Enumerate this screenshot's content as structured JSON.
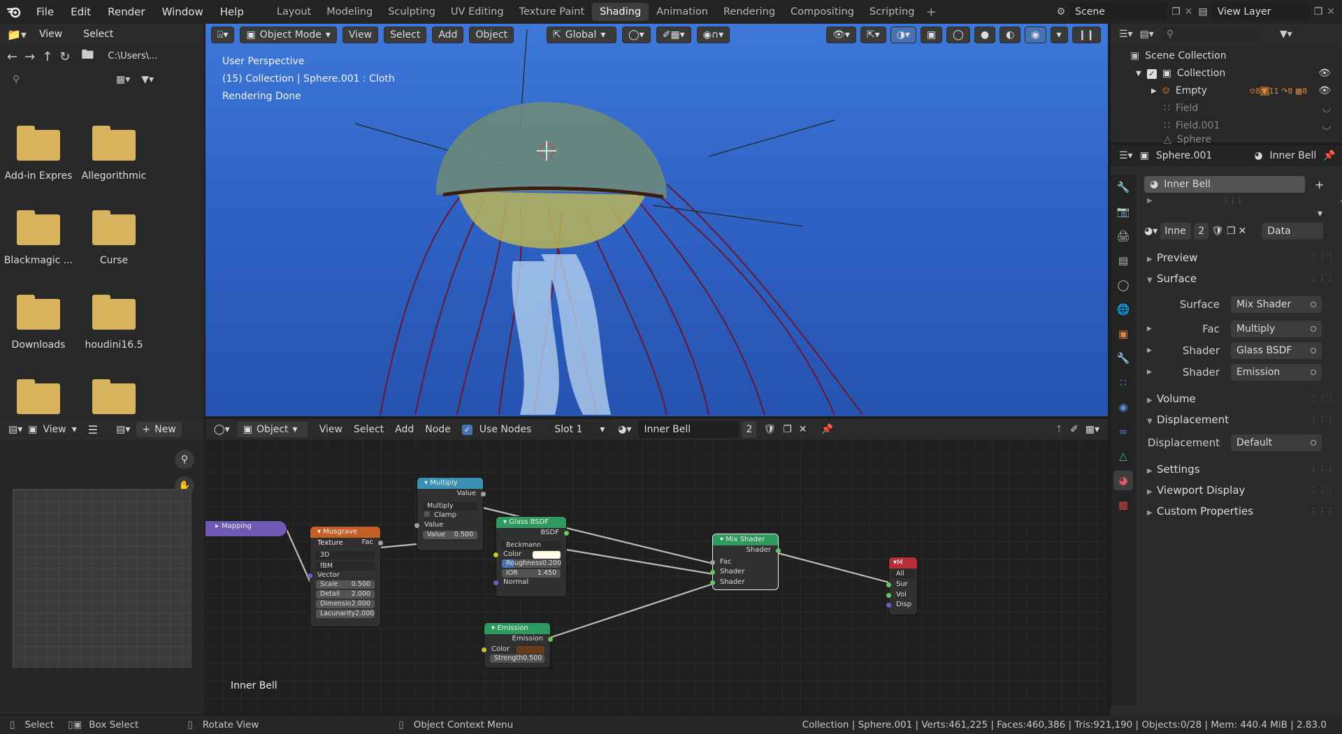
{
  "topbar": {
    "menus": [
      "File",
      "Edit",
      "Render",
      "Window",
      "Help"
    ],
    "workspaces": [
      "Layout",
      "Modeling",
      "Sculpting",
      "UV Editing",
      "Texture Paint",
      "Shading",
      "Animation",
      "Rendering",
      "Compositing",
      "Scripting"
    ],
    "active_workspace": "Shading",
    "scene": "Scene",
    "view_layer": "View Layer"
  },
  "file_browser": {
    "menus": [
      "View",
      "Select"
    ],
    "path": "C:\\Users\\...",
    "folders": [
      "Add-in Expres",
      "Allegorithmic",
      "Blackmagic ...",
      "Curse",
      "Downloads",
      "houdini16.5",
      "",
      ""
    ]
  },
  "viewport": {
    "mode": "Object Mode",
    "menus": [
      "View",
      "Select",
      "Add",
      "Object"
    ],
    "transform": "Global",
    "overlay_lines": [
      "User Perspective",
      "(15) Collection | Sphere.001 : Cloth",
      "Rendering Done"
    ]
  },
  "image_editor": {
    "view_label": "View",
    "new_label": "New"
  },
  "node_editor": {
    "type": "Object",
    "menus": [
      "View",
      "Select",
      "Add",
      "Node"
    ],
    "use_nodes_label": "Use Nodes",
    "slot": "Slot 1",
    "material": "Inner Bell",
    "users": "2",
    "material_label": "Inner Bell",
    "nodes": {
      "mapping": {
        "title": "Mapping"
      },
      "musgrave": {
        "title": "Musgrave Texture",
        "out": "Fac",
        "dim": "3D",
        "type": "fBM",
        "vector": "Vector",
        "fields": [
          {
            "label": "Scale",
            "value": "0.500"
          },
          {
            "label": "Detail",
            "value": "2.000"
          },
          {
            "label": "Dimensio",
            "value": "2.000"
          },
          {
            "label": "Lacunarity",
            "value": "2.000"
          }
        ]
      },
      "multiply": {
        "title": "Multiply",
        "out": "Value",
        "op": "Multiply",
        "clamp": "Clamp",
        "in": "Value",
        "field_label": "Value",
        "field_value": "0.500"
      },
      "glass": {
        "title": "Glass BSDF",
        "out": "BSDF",
        "dist": "Beckmann",
        "color": "Color",
        "rough_label": "Roughness",
        "rough_value": "0.200",
        "ior_label": "IOR",
        "ior_value": "1.450",
        "normal": "Normal"
      },
      "emission": {
        "title": "Emission",
        "out": "Emission",
        "color": "Color",
        "strength_label": "Strength",
        "strength_value": "0.500"
      },
      "mix": {
        "title": "Mix Shader",
        "out": "Shader",
        "fac": "Fac",
        "s1": "Shader",
        "s2": "Shader"
      },
      "output": {
        "title": "M",
        "all": "All",
        "rows": [
          "Sur",
          "Vol",
          "Disp"
        ]
      }
    }
  },
  "outliner": {
    "root": "Scene Collection",
    "items": [
      "Collection",
      "Empty",
      "Field",
      "Field.001",
      "Sphere"
    ],
    "badges": [
      "8",
      "11",
      "8",
      "8"
    ]
  },
  "properties": {
    "object": "Sphere.001",
    "material": "Inner Bell",
    "slot_name": "Inner Bell",
    "mat_short": "Inne",
    "users": "2",
    "link": "Data",
    "panels": {
      "preview": "Preview",
      "surface": "Surface",
      "volume": "Volume",
      "displacement": "Displacement",
      "settings": "Settings",
      "viewport_display": "Viewport Display",
      "custom_props": "Custom Properties"
    },
    "surface_rows": [
      {
        "label": "Surface",
        "value": "Mix Shader"
      },
      {
        "label": "Fac",
        "value": "Multiply"
      },
      {
        "label": "Shader",
        "value": "Glass BSDF"
      },
      {
        "label": "Shader",
        "value": "Emission"
      }
    ],
    "disp_row": {
      "label": "Displacement",
      "value": "Default"
    }
  },
  "statusbar": {
    "select": "Select",
    "box_select": "Box Select",
    "rotate": "Rotate View",
    "context": "Object Context Menu",
    "stats": "Collection | Sphere.001 | Verts:461,225 | Faces:460,386 | Tris:921,190 | Objects:0/28 | Mem: 440.4 MiB | 2.83.0"
  },
  "colors": {
    "accent": "#4772b3",
    "active_tab": "#3d3d3d",
    "viewport_sky": "#2f63c6"
  }
}
